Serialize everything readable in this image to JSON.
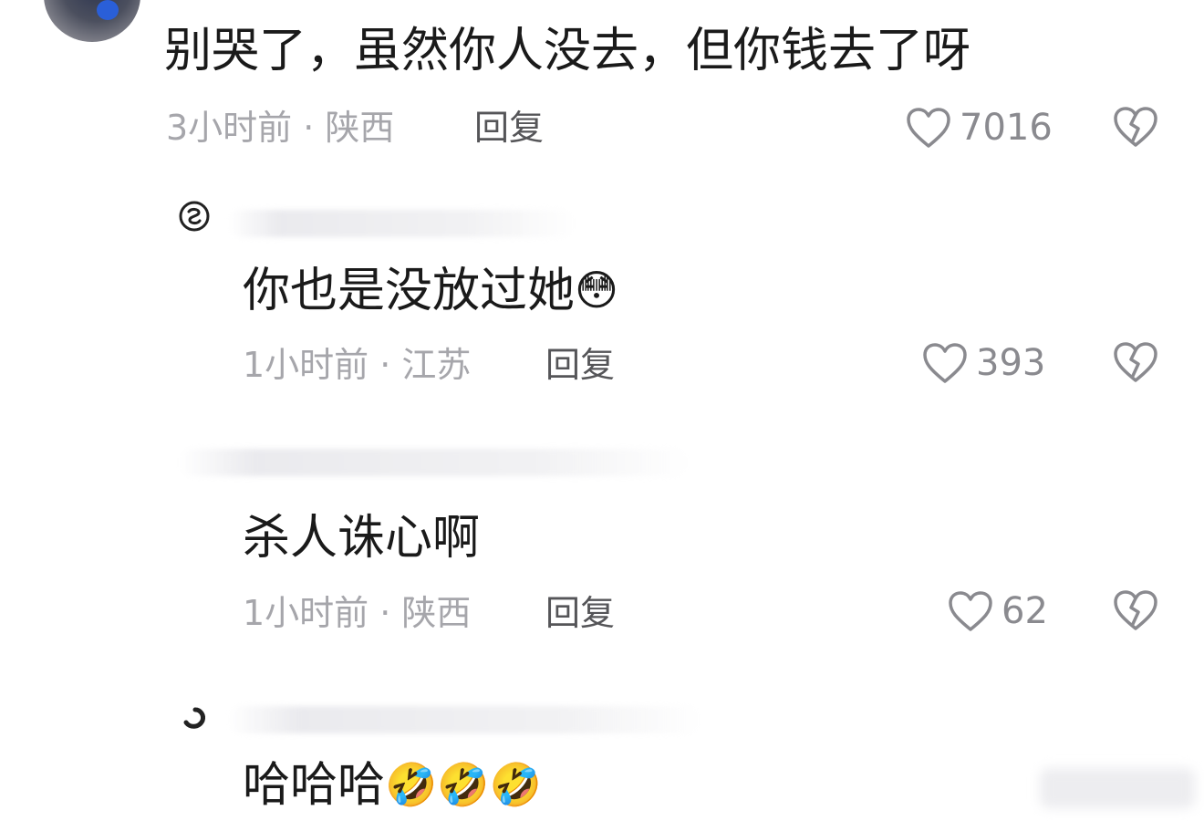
{
  "comments": [
    {
      "text": "别哭了，虽然你人没去，但你钱去了呀",
      "time_location": "3小时前 · 陕西",
      "reply_label": "回复",
      "likes": "7016"
    },
    {
      "text": "你也是没放过她",
      "emoji": "😳",
      "time_location": "1小时前 · 江苏",
      "reply_label": "回复",
      "likes": "393"
    },
    {
      "text": "杀人诛心啊",
      "time_location": "1小时前 · 陕西",
      "reply_label": "回复",
      "likes": "62"
    },
    {
      "text": "哈哈哈",
      "emoji": "🤣🤣🤣"
    }
  ],
  "icons": {
    "like": "heart-outline-icon",
    "dislike": "broken-heart-icon"
  },
  "colors": {
    "text": "#1a1a1a",
    "meta": "#a6a6ab",
    "reply": "#555558",
    "icon": "#8a8a8f"
  }
}
